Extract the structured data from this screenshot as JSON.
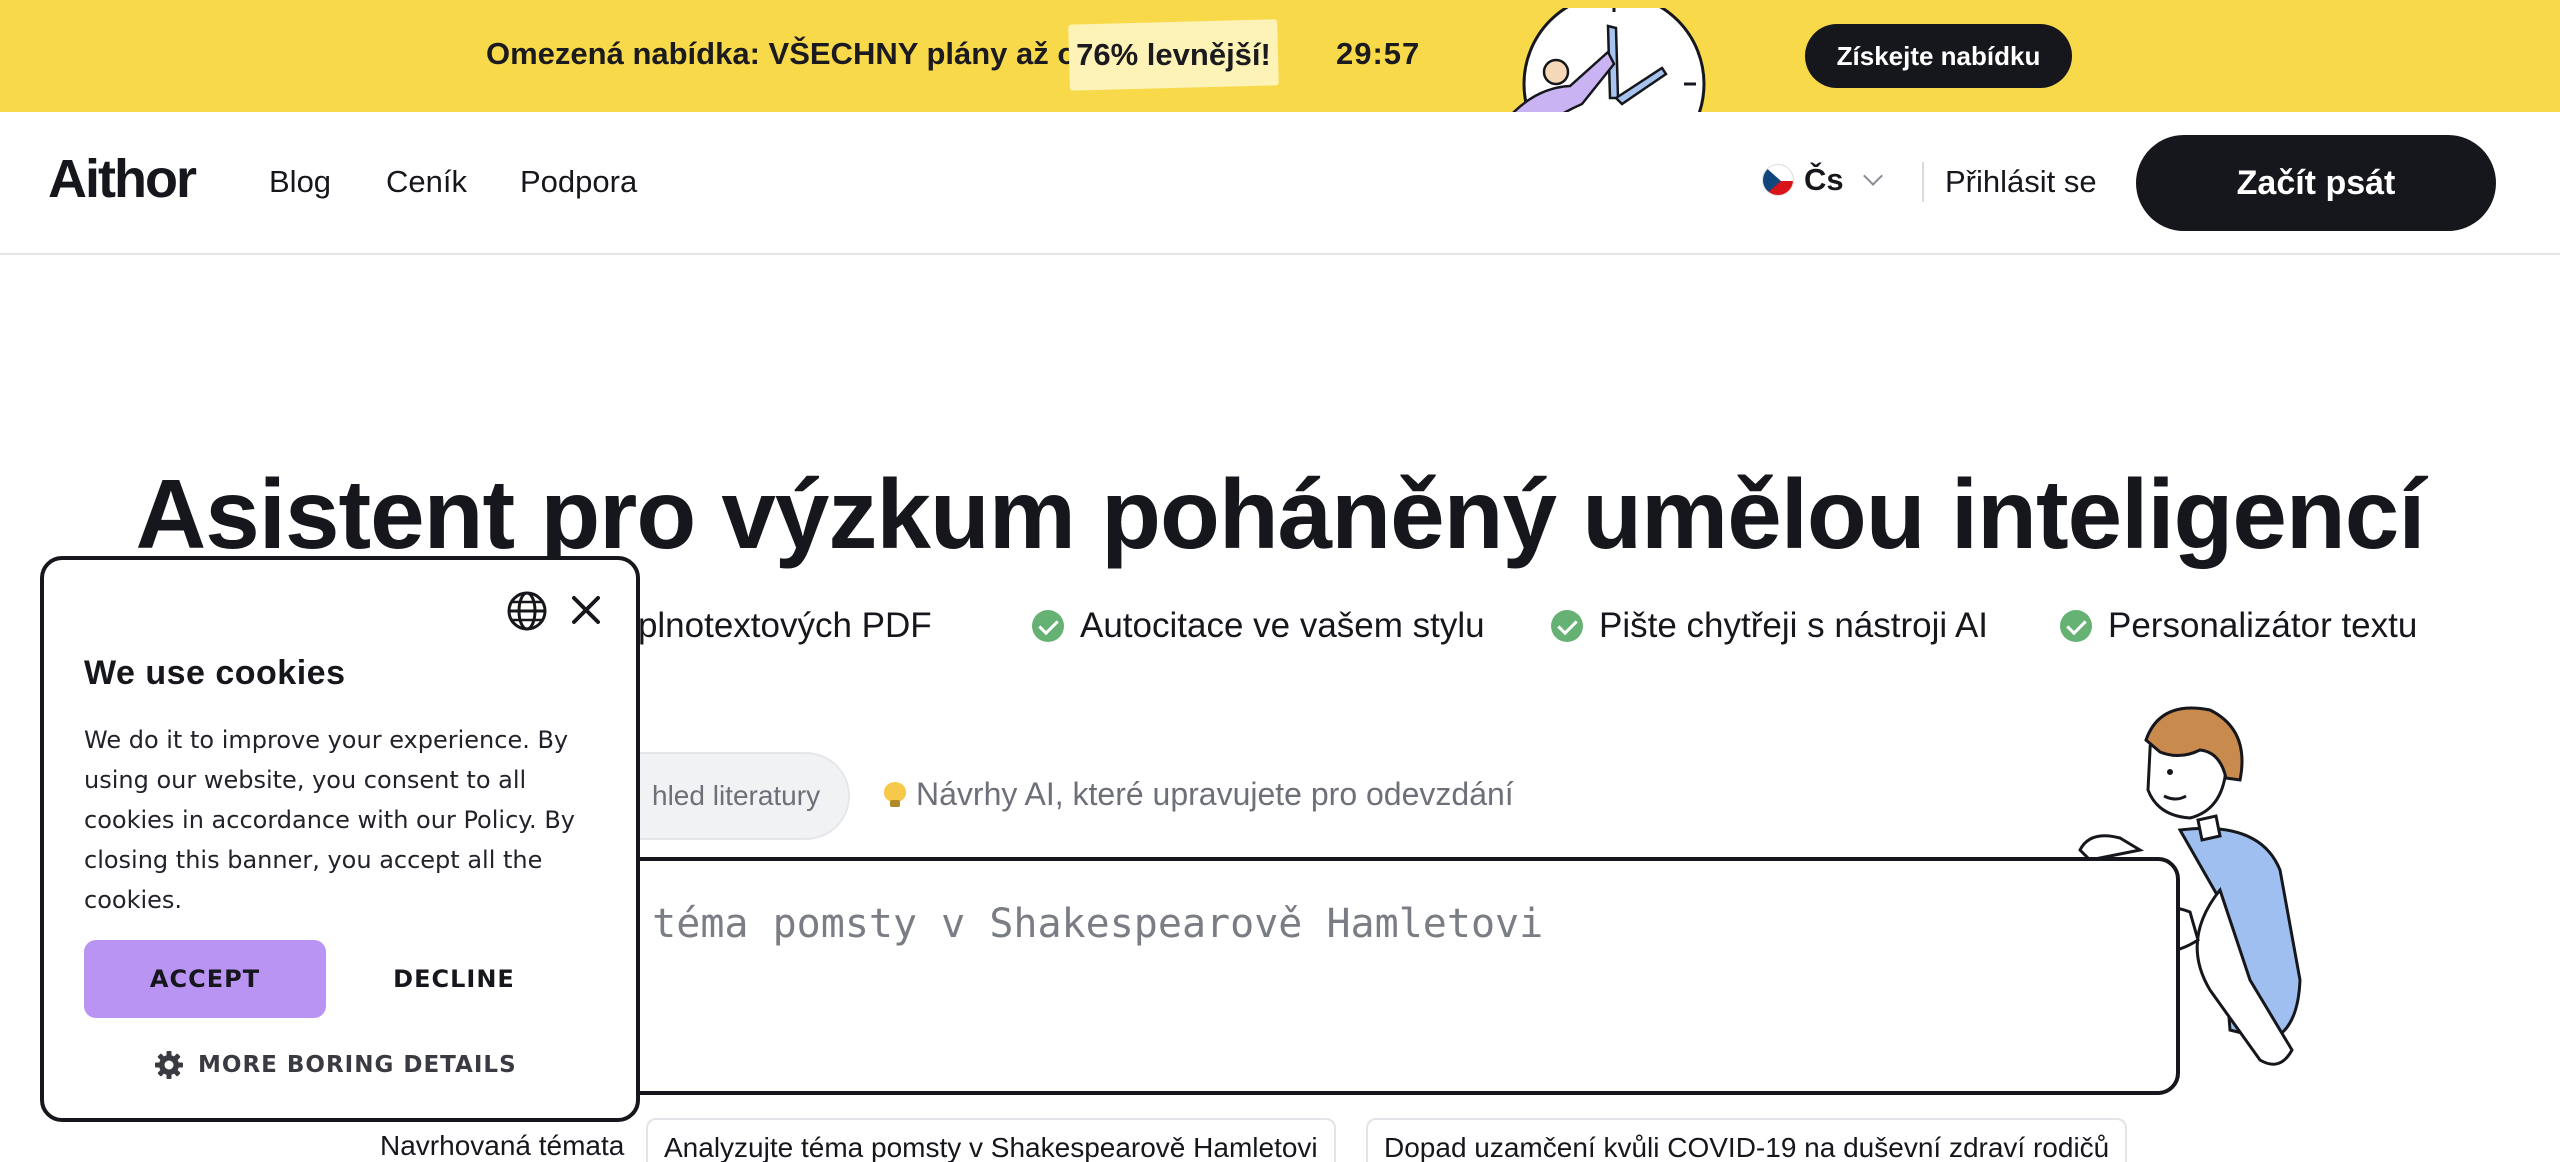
{
  "promo": {
    "text": "Omezená nabídka: VŠECHNY plány až o",
    "highlight": "76% levnější!",
    "timer": "29:57",
    "cta": "Získejte nabídku"
  },
  "nav": {
    "logo": "Aithor",
    "links": [
      "Blog",
      "Ceník",
      "Podpora"
    ],
    "language": "Čs",
    "login": "Přihlásit se",
    "start": "Začít psát"
  },
  "hero": {
    "title": "Asistent pro výzkum poháněný umělou inteligencí",
    "features": [
      "l+ plnotextových PDF",
      "Autocitace ve vašem stylu",
      "Pište chytřeji s nástroji AI",
      "Personalizátor textu"
    ]
  },
  "tabs": {
    "review": "hled literatury",
    "ai_suggestions": "Návrhy AI, které upravujete pro odevzdání"
  },
  "editor": {
    "placeholder": "e téma pomsty v Shakespearově Hamletovi"
  },
  "topics": {
    "label": "Navrhovaná témata",
    "items": [
      "Analyzujte téma pomsty v Shakespearově Hamletovi",
      "Dopad uzamčení kvůli COVID-19 na duševní zdraví rodičů"
    ]
  },
  "cookie": {
    "title": "We use cookies",
    "body": "We do it to improve your experience. By using our website, you consent to all cookies in accordance with our Policy. By closing this banner, you accept all the cookies.",
    "accept": "ACCEPT",
    "decline": "DECLINE",
    "more": "MORE BORING DETAILS"
  },
  "colors": {
    "promo_bg": "#f8d94a",
    "dark": "#16171c",
    "accent_purple": "#b994f3",
    "check_green": "#66b174"
  },
  "icons": [
    "clock-illustration",
    "flag-cz-icon",
    "chevron-down-icon",
    "check-icon",
    "bulb-icon",
    "globe-icon",
    "close-icon",
    "gear-icon",
    "character-illustration"
  ]
}
